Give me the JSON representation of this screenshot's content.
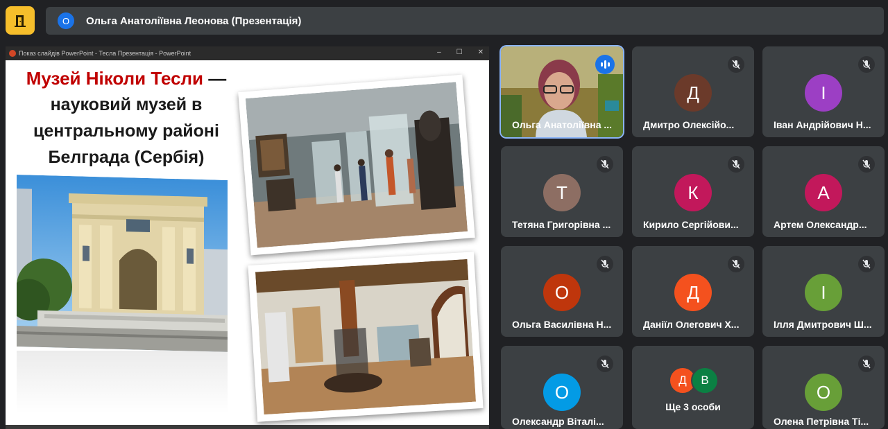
{
  "header": {
    "presenter_initial": "О",
    "presenter_title": "Ольга Анатоліївна Леонова (Презентація)"
  },
  "shared_window": {
    "titlebar": "Показ слайдів PowerPoint  -  Тесла Презентація - PowerPoint",
    "controls": [
      "–",
      "☐",
      "✕"
    ],
    "slide": {
      "title_line1": "Музей Ніколи Тесли",
      "title_dash": " —",
      "title_rest": [
        "науковий музей в",
        "центральному районі",
        "Белграда (Сербія)"
      ]
    }
  },
  "participants": [
    {
      "name": "Ольга Анатоліївна ...",
      "video": true,
      "speaking": true
    },
    {
      "name": "Дмитро Олексійо...",
      "initial": "Д",
      "color": "#6b3a2a",
      "muted": true
    },
    {
      "name": "Іван Андрійович Н...",
      "initial": "І",
      "color": "#9c3fc4",
      "muted": true
    },
    {
      "name": "Тетяна Григорівна ...",
      "initial": "Т",
      "color": "#8d6e63",
      "muted": true
    },
    {
      "name": "Кирило Сергійови...",
      "initial": "К",
      "color": "#c2185b",
      "muted": true
    },
    {
      "name": "Артем Олександр...",
      "initial": "А",
      "color": "#c2185b",
      "muted": true
    },
    {
      "name": "Ольга Василівна Н...",
      "initial": "О",
      "color": "#bf360c",
      "muted": true
    },
    {
      "name": "Даніїл Олегович Х...",
      "initial": "Д",
      "color": "#f4511e",
      "muted": true
    },
    {
      "name": "Ілля Дмитрович Ш...",
      "initial": "І",
      "color": "#689f38",
      "muted": true
    },
    {
      "name": "Олександр Віталі...",
      "initial": "О",
      "color": "#039be5",
      "muted": true
    },
    {
      "more_label": "Ще 3 особи",
      "initials": [
        "Д",
        "В"
      ],
      "colors": [
        "#f4511e",
        "#0b8043"
      ]
    },
    {
      "name": "Олена Петрівна Ті...",
      "initial": "О",
      "color": "#689f38",
      "muted": true
    }
  ]
}
